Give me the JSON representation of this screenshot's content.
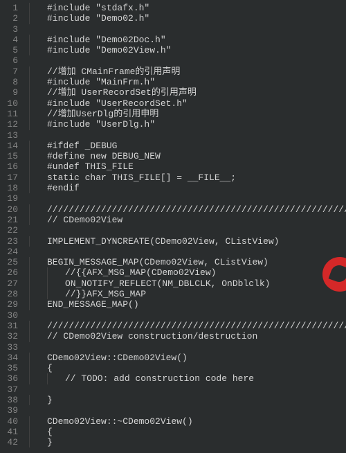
{
  "lines": [
    {
      "n": 1,
      "indent": 1,
      "text": "#include \"stdafx.h\""
    },
    {
      "n": 2,
      "indent": 1,
      "text": "#include \"Demo02.h\""
    },
    {
      "n": 3,
      "indent": 0,
      "text": ""
    },
    {
      "n": 4,
      "indent": 1,
      "text": "#include \"Demo02Doc.h\""
    },
    {
      "n": 5,
      "indent": 1,
      "text": "#include \"Demo02View.h\""
    },
    {
      "n": 6,
      "indent": 0,
      "text": ""
    },
    {
      "n": 7,
      "indent": 1,
      "text": "//增加 CMainFrame的引用声明"
    },
    {
      "n": 8,
      "indent": 1,
      "text": "#include \"MainFrm.h\""
    },
    {
      "n": 9,
      "indent": 1,
      "text": "//增加 UserRecordSet的引用声明"
    },
    {
      "n": 10,
      "indent": 1,
      "text": "#include \"UserRecordSet.h\""
    },
    {
      "n": 11,
      "indent": 1,
      "text": "//增加UserDlg的引用申明"
    },
    {
      "n": 12,
      "indent": 1,
      "text": "#include \"UserDlg.h\""
    },
    {
      "n": 13,
      "indent": 0,
      "text": ""
    },
    {
      "n": 14,
      "indent": 1,
      "text": "#ifdef _DEBUG"
    },
    {
      "n": 15,
      "indent": 1,
      "text": "#define new DEBUG_NEW"
    },
    {
      "n": 16,
      "indent": 1,
      "text": "#undef THIS_FILE"
    },
    {
      "n": 17,
      "indent": 1,
      "text": "static char THIS_FILE[] = __FILE__;"
    },
    {
      "n": 18,
      "indent": 1,
      "text": "#endif"
    },
    {
      "n": 19,
      "indent": 0,
      "text": ""
    },
    {
      "n": 20,
      "indent": 1,
      "text": "/////////////////////////////////////////////////////////////////////////////"
    },
    {
      "n": 21,
      "indent": 1,
      "text": "// CDemo02View"
    },
    {
      "n": 22,
      "indent": 0,
      "text": ""
    },
    {
      "n": 23,
      "indent": 1,
      "text": "IMPLEMENT_DYNCREATE(CDemo02View, CListView)"
    },
    {
      "n": 24,
      "indent": 0,
      "text": ""
    },
    {
      "n": 25,
      "indent": 1,
      "text": "BEGIN_MESSAGE_MAP(CDemo02View, CListView)"
    },
    {
      "n": 26,
      "indent": 2,
      "text": "//{{AFX_MSG_MAP(CDemo02View)"
    },
    {
      "n": 27,
      "indent": 2,
      "text": "ON_NOTIFY_REFLECT(NM_DBLCLK, OnDblclk)"
    },
    {
      "n": 28,
      "indent": 2,
      "text": "//}}AFX_MSG_MAP"
    },
    {
      "n": 29,
      "indent": 1,
      "text": "END_MESSAGE_MAP()"
    },
    {
      "n": 30,
      "indent": 0,
      "text": ""
    },
    {
      "n": 31,
      "indent": 1,
      "text": "/////////////////////////////////////////////////////////////////////////////"
    },
    {
      "n": 32,
      "indent": 1,
      "text": "// CDemo02View construction/destruction"
    },
    {
      "n": 33,
      "indent": 0,
      "text": ""
    },
    {
      "n": 34,
      "indent": 1,
      "text": "CDemo02View::CDemo02View()"
    },
    {
      "n": 35,
      "indent": 1,
      "text": "{"
    },
    {
      "n": 36,
      "indent": 2,
      "text": "// TODO: add construction code here"
    },
    {
      "n": 37,
      "indent": 0,
      "text": ""
    },
    {
      "n": 38,
      "indent": 1,
      "text": "}"
    },
    {
      "n": 39,
      "indent": 0,
      "text": ""
    },
    {
      "n": 40,
      "indent": 1,
      "text": "CDemo02View::~CDemo02View()"
    },
    {
      "n": 41,
      "indent": 1,
      "text": "{"
    },
    {
      "n": 42,
      "indent": 1,
      "text": "}"
    }
  ]
}
